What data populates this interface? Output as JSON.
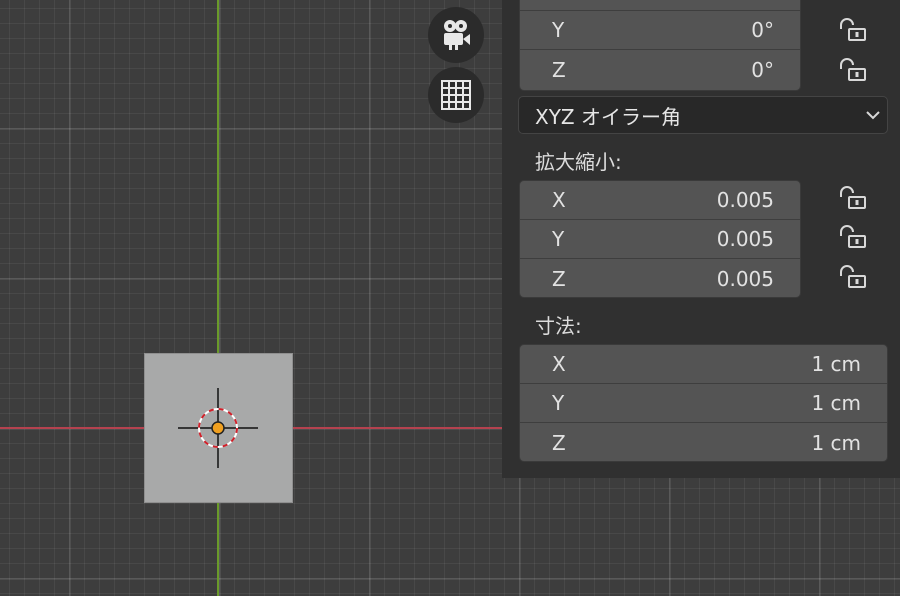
{
  "rotation": {
    "rows": [
      {
        "axis": "Y",
        "value": "0°"
      },
      {
        "axis": "Z",
        "value": "0°"
      }
    ],
    "mode": "XYZ オイラー角"
  },
  "scale": {
    "label": "拡大縮小:",
    "rows": [
      {
        "axis": "X",
        "value": "0.005"
      },
      {
        "axis": "Y",
        "value": "0.005"
      },
      {
        "axis": "Z",
        "value": "0.005"
      }
    ]
  },
  "dimensions": {
    "label": "寸法:",
    "rows": [
      {
        "axis": "X",
        "value": "1 cm"
      },
      {
        "axis": "Y",
        "value": "1 cm"
      },
      {
        "axis": "Z",
        "value": "1 cm"
      }
    ]
  },
  "icons": {
    "camera": "camera-view-icon",
    "grid": "orthographic-grid-icon",
    "lock": "unlocked-padlock-icon",
    "chevron": "chevron-down-icon"
  },
  "colors": {
    "x_axis": "#b5424f",
    "y_axis": "#6a9a2a",
    "origin": "#f0a020"
  }
}
